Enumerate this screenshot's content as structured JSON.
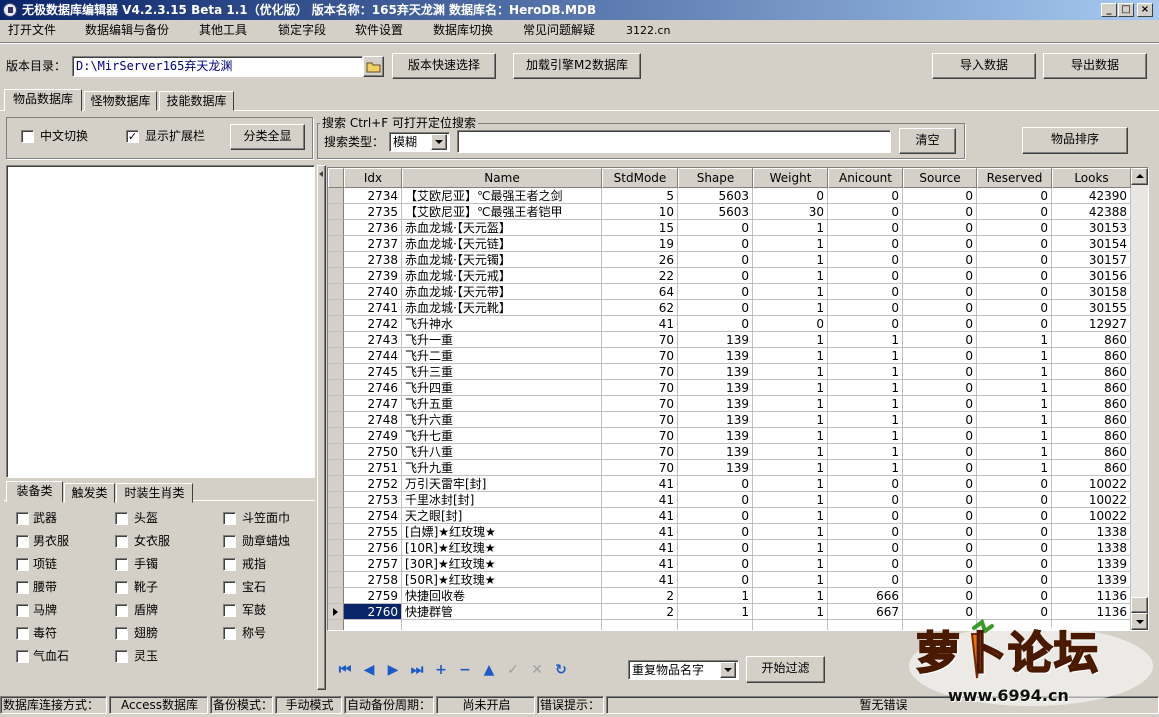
{
  "window": {
    "title": "无极数据库编辑器 V4.2.3.15    Beta 1.1（优化版）    版本名称：165弃天龙渊      数据库名：HeroDB.MDB",
    "controls": [
      "_",
      "□",
      "×"
    ]
  },
  "menu": [
    "打开文件",
    "数据编辑与备份",
    "其他工具",
    "锁定字段",
    "软件设置",
    "数据库切换",
    "常见问题解疑",
    "3122.cn"
  ],
  "toolbar": {
    "version_dir_label": "版本目录：",
    "version_dir_value": "D:\\MirServer165弃天龙渊",
    "quick_select": "版本快速选择",
    "load_m2": "加载引擎M2数据库",
    "import": "导入数据",
    "export": "导出数据"
  },
  "tabs": [
    "物品数据库",
    "怪物数据库",
    "技能数据库"
  ],
  "options": {
    "chinese_switch": "中文切换",
    "chinese_switch_checked": false,
    "show_ext": "显示扩展栏",
    "show_ext_checked": true,
    "show_all": "分类全显"
  },
  "search": {
    "group_title": "搜索  Ctrl+F 可打开定位搜索",
    "type_label": "搜索类型：",
    "type_value": "模糊",
    "query": "",
    "clear": "清空",
    "sort": "物品排序"
  },
  "category_tabs": [
    "装备类",
    "触发类",
    "时装生肖类"
  ],
  "categories": [
    [
      "武器",
      "头盔",
      "斗笠面巾"
    ],
    [
      "男衣服",
      "女衣服",
      "勋章蜡烛"
    ],
    [
      "项链",
      "手镯",
      "戒指"
    ],
    [
      "腰带",
      "靴子",
      "宝石"
    ],
    [
      "马牌",
      "盾牌",
      "军鼓"
    ],
    [
      "毒符",
      "翅膀",
      "称号"
    ],
    [
      "气血石",
      "灵玉",
      ""
    ]
  ],
  "grid": {
    "columns": [
      "Idx",
      "Name",
      "StdMode",
      "Shape",
      "Weight",
      "Anicount",
      "Source",
      "Reserved",
      "Looks"
    ],
    "selected_index": 26,
    "rows": [
      [
        "2734",
        "【艾欧尼亚】℃最强王者之剑",
        "5",
        "5603",
        "0",
        "0",
        "0",
        "0",
        "42390"
      ],
      [
        "2735",
        "【艾欧尼亚】℃最强王者铠甲",
        "10",
        "5603",
        "30",
        "0",
        "0",
        "0",
        "42388"
      ],
      [
        "2736",
        "赤血龙城·【天元盔】",
        "15",
        "0",
        "1",
        "0",
        "0",
        "0",
        "30153"
      ],
      [
        "2737",
        "赤血龙城·【天元链】",
        "19",
        "0",
        "1",
        "0",
        "0",
        "0",
        "30154"
      ],
      [
        "2738",
        "赤血龙城·【天元镯】",
        "26",
        "0",
        "1",
        "0",
        "0",
        "0",
        "30157"
      ],
      [
        "2739",
        "赤血龙城·【天元戒】",
        "22",
        "0",
        "1",
        "0",
        "0",
        "0",
        "30156"
      ],
      [
        "2740",
        "赤血龙城·【天元带】",
        "64",
        "0",
        "1",
        "0",
        "0",
        "0",
        "30158"
      ],
      [
        "2741",
        "赤血龙城·【天元靴】",
        "62",
        "0",
        "1",
        "0",
        "0",
        "0",
        "30155"
      ],
      [
        "2742",
        "飞升神水",
        "41",
        "0",
        "0",
        "0",
        "0",
        "0",
        "12927"
      ],
      [
        "2743",
        "飞升一重",
        "70",
        "139",
        "1",
        "1",
        "0",
        "1",
        "860"
      ],
      [
        "2744",
        "飞升二重",
        "70",
        "139",
        "1",
        "1",
        "0",
        "1",
        "860"
      ],
      [
        "2745",
        "飞升三重",
        "70",
        "139",
        "1",
        "1",
        "0",
        "1",
        "860"
      ],
      [
        "2746",
        "飞升四重",
        "70",
        "139",
        "1",
        "1",
        "0",
        "1",
        "860"
      ],
      [
        "2747",
        "飞升五重",
        "70",
        "139",
        "1",
        "1",
        "0",
        "1",
        "860"
      ],
      [
        "2748",
        "飞升六重",
        "70",
        "139",
        "1",
        "1",
        "0",
        "1",
        "860"
      ],
      [
        "2749",
        "飞升七重",
        "70",
        "139",
        "1",
        "1",
        "0",
        "1",
        "860"
      ],
      [
        "2750",
        "飞升八重",
        "70",
        "139",
        "1",
        "1",
        "0",
        "1",
        "860"
      ],
      [
        "2751",
        "飞升九重",
        "70",
        "139",
        "1",
        "1",
        "0",
        "1",
        "860"
      ],
      [
        "2752",
        "万引天雷牢[封]",
        "41",
        "0",
        "1",
        "0",
        "0",
        "0",
        "10022"
      ],
      [
        "2753",
        "千里冰封[封]",
        "41",
        "0",
        "1",
        "0",
        "0",
        "0",
        "10022"
      ],
      [
        "2754",
        "天之眼[封]",
        "41",
        "0",
        "1",
        "0",
        "0",
        "0",
        "10022"
      ],
      [
        "2755",
        "[白嫖]★红玫瑰★",
        "41",
        "0",
        "1",
        "0",
        "0",
        "0",
        "1338"
      ],
      [
        "2756",
        "[10R]★红玫瑰★",
        "41",
        "0",
        "1",
        "0",
        "0",
        "0",
        "1338"
      ],
      [
        "2757",
        "[30R]★红玫瑰★",
        "41",
        "0",
        "1",
        "0",
        "0",
        "0",
        "1339"
      ],
      [
        "2758",
        "[50R]★红玫瑰★",
        "41",
        "0",
        "1",
        "0",
        "0",
        "0",
        "1339"
      ],
      [
        "2759",
        "快捷回收卷",
        "2",
        "1",
        "1",
        "666",
        "0",
        "0",
        "1136"
      ],
      [
        "2760",
        "快捷群管",
        "2",
        "1",
        "1",
        "667",
        "0",
        "0",
        "1136"
      ]
    ]
  },
  "bottom": {
    "filter_value": "重复物品名字",
    "start_filter": "开始过滤"
  },
  "statusbar": [
    "数据库连接方式：",
    "Access数据库",
    "备份模式：",
    "手动模式",
    "自动备份周期：",
    "尚未开启",
    "错误提示：",
    "暂无错误"
  ],
  "watermark": {
    "brand": "萝卜论坛",
    "url": "www.6994.cn"
  }
}
